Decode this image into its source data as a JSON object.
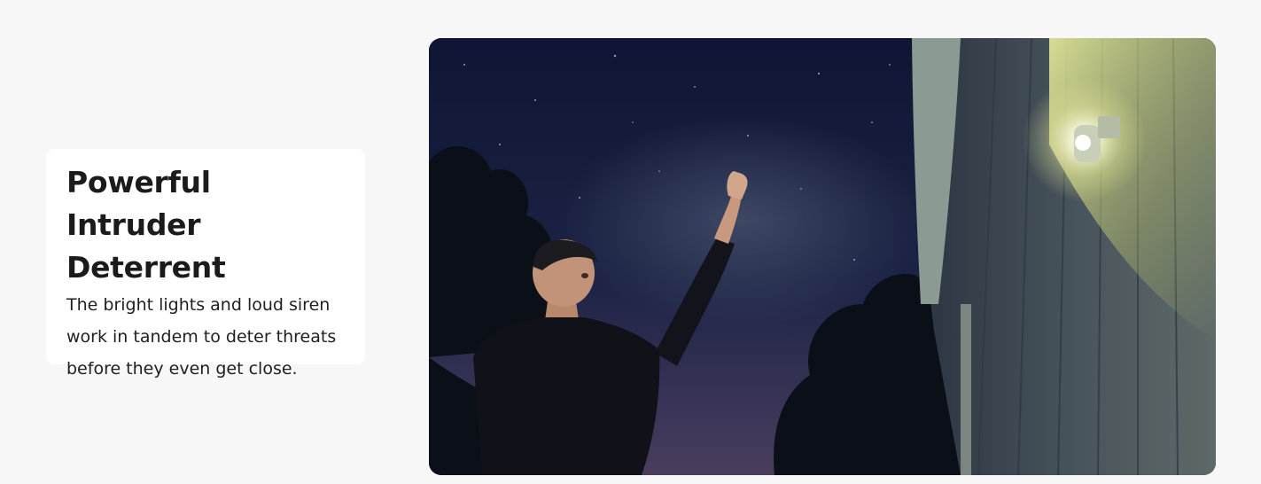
{
  "feature": {
    "title": "Powerful Intruder Deterrent",
    "description": "The bright lights and loud siren work in tandem to deter threats before they even get close."
  },
  "photo": {
    "subject": "man-raising-hand-under-floodlight-camera-at-night"
  },
  "colors": {
    "page_background": "#f7f7f7",
    "card_background": "#ffffff",
    "text": "#1b1b1b",
    "night_sky": "#141a33",
    "light_glow": "#f2f5c8"
  }
}
